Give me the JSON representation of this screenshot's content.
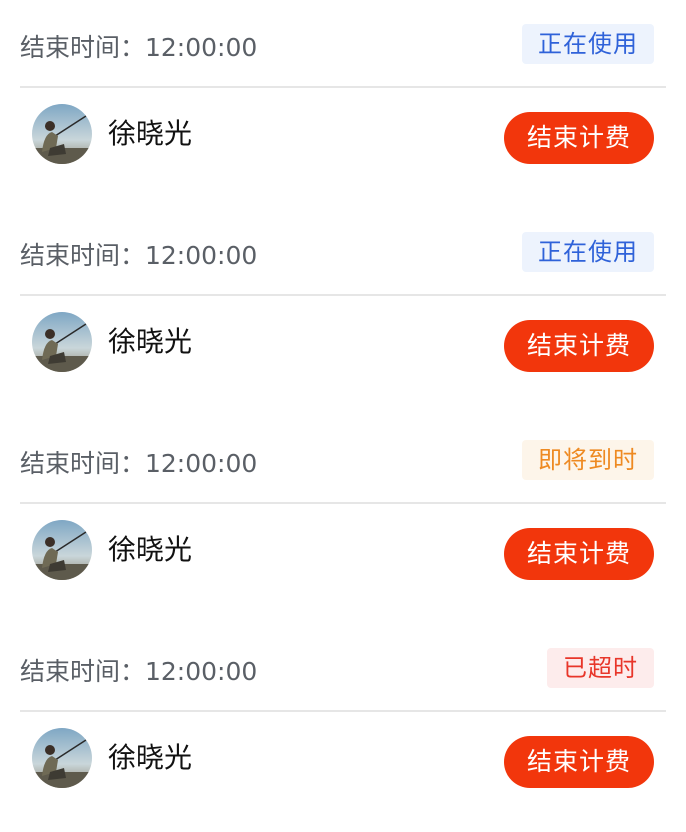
{
  "colors": {
    "button_bg": "#f2360c",
    "status_using_text": "#2f62d9",
    "status_using_bg": "#edf3fd",
    "status_soon_text": "#ee8a22",
    "status_soon_bg": "#fdf5ea",
    "status_overtime_text": "#e8362a",
    "status_overtime_bg": "#fdecec"
  },
  "cards": [
    {
      "end_time_label": "结束时间：12:00:00",
      "status": {
        "label": "正在使用",
        "type": "using"
      },
      "user": {
        "name": "徐晓光",
        "avatar_icon": "avatar-photo"
      },
      "action_label": "结束计费"
    },
    {
      "end_time_label": "结束时间：12:00:00",
      "status": {
        "label": "正在使用",
        "type": "using"
      },
      "user": {
        "name": "徐晓光",
        "avatar_icon": "avatar-photo"
      },
      "action_label": "结束计费"
    },
    {
      "end_time_label": "结束时间：12:00:00",
      "status": {
        "label": "即将到时",
        "type": "soon"
      },
      "user": {
        "name": "徐晓光",
        "avatar_icon": "avatar-photo"
      },
      "action_label": "结束计费"
    },
    {
      "end_time_label": "结束时间：12:00:00",
      "status": {
        "label": "已超时",
        "type": "overtime"
      },
      "user": {
        "name": "徐晓光",
        "avatar_icon": "avatar-photo"
      },
      "action_label": "结束计费"
    }
  ]
}
